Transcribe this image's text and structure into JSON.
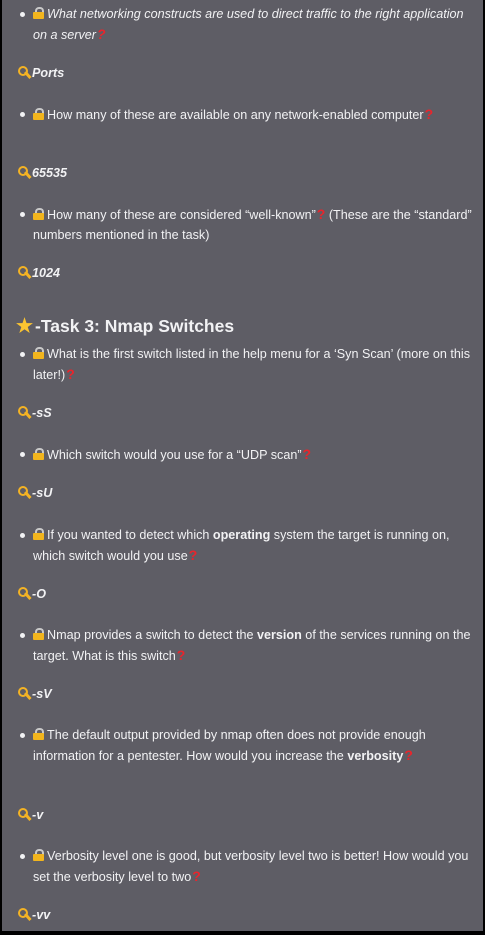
{
  "items": [
    {
      "q": "What networking constructs are used to direct traffic to the right application on a server",
      "a": "Ports"
    },
    {
      "q": "How many of these are available on any network-enabled computer",
      "a": "65535"
    },
    {
      "q": "How many of these are considered “well-known”",
      "q_suffix": "(These are the “standard” numbers mentioned in the task)",
      "a": "1024"
    }
  ],
  "section": {
    "title": "-Task 3: Nmap Switches",
    "icon": "star-icon"
  },
  "task3": [
    {
      "q": "What is the first switch listed in the help menu for a ‘Syn Scan’ (more on this later!)",
      "a": "-sS"
    },
    {
      "q": "Which switch would you use for a “UDP scan”",
      "a": "-sU"
    },
    {
      "q_pre": "If you wanted to detect which ",
      "q_bold": "operating",
      "q_post": " system the target is running on, which switch would you use",
      "a": "-O"
    },
    {
      "q_pre": "Nmap provides a switch to detect the ",
      "q_bold": "version",
      "q_post": " of the services running on the target. What is this switch",
      "a": "-sV"
    },
    {
      "q_pre": "The default output provided by nmap often does not provide enough information for a pentester. How would you increase the ",
      "q_bold": "verbosity",
      "a": "-v"
    },
    {
      "q": "Verbosity level one is good, but verbosity level two is better! How would you set the verbosity level to two",
      "a": "-vv"
    }
  ],
  "colors": {
    "panel": "#5e5d65",
    "text": "#f2f2f4",
    "key": "#f4b324",
    "qmark": "#e8252c",
    "star": "#fbc531"
  }
}
